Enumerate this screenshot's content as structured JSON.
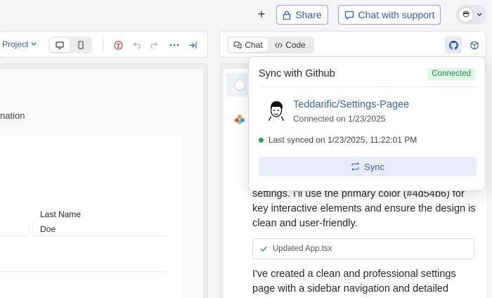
{
  "topbar": {
    "share_label": "Share",
    "support_label": "Chat with support"
  },
  "left_toolbar": {
    "project_label": "Project"
  },
  "preview": {
    "section_fragment": "nation",
    "last_name_label": "Last Name",
    "last_name_value": "Doe"
  },
  "right_toolbar": {
    "chat_tab": "Chat",
    "code_tab": "Code"
  },
  "chat": {
    "message_1": "settings. I'll use the primary color (#4d54b6) for key interactive elements and ensure the design is clean and user-friendly.",
    "update_label": "Updated App.tsx",
    "message_2": "I've created a clean and professional settings page with a sidebar navigation and detailed"
  },
  "sync_popover": {
    "title": "Sync with Github",
    "status_badge": "Connected",
    "repo_name": "Teddarific/Settings-Pagee",
    "connected_on": "Connected on 1/23/2025",
    "last_synced": "Last synced on 1/23/2025, 11:22:01 PM",
    "sync_label": "Sync"
  },
  "colors": {
    "accent": "#3560c0",
    "connected_green": "#1e8a4a"
  }
}
